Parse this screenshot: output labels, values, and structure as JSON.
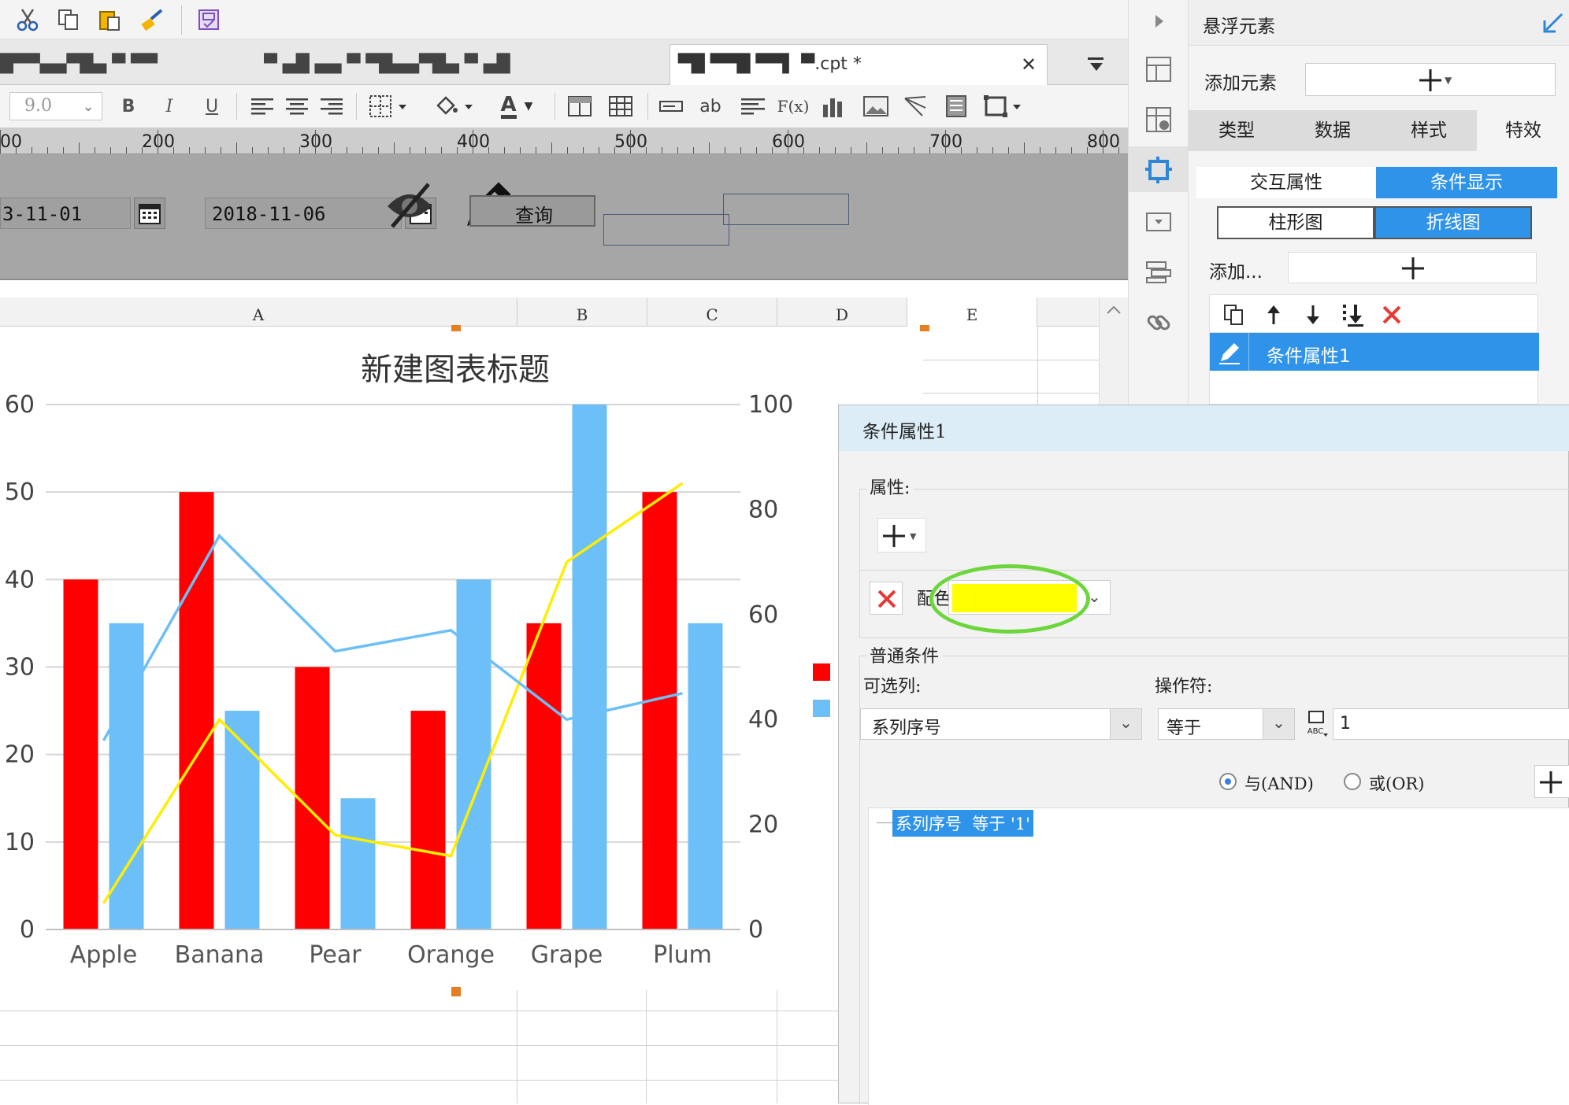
{
  "toolbar": {
    "font_size": "9.0",
    "bold": "B",
    "italic": "I",
    "underline": "U",
    "text_color_glyph": "A",
    "text_tool_glyph": "ab",
    "formula_glyph": "F(x)"
  },
  "tabs": [
    {
      "label": "█▀▀▄▄▀█▄ ▀ ▀▀"
    },
    {
      "label": "▀ ▄█ ▄▄ ▀ ▀█▄▄▀█▄ ▀ ▄█"
    },
    {
      "label": "▀█ ▀▀█ ▀▀▌ ▀.cpt *",
      "active": true
    }
  ],
  "ruler": [
    "00",
    "200",
    "300",
    "400",
    "500",
    "600",
    "700",
    "800"
  ],
  "params": {
    "start_date": "3-11-01",
    "end_date": "2018-11-06",
    "query_label": "查询"
  },
  "columns": [
    "A",
    "B",
    "C",
    "D",
    "E"
  ],
  "chart_data": {
    "type": "bar",
    "title": "新建图表标题",
    "categories": [
      "Apple",
      "Banana",
      "Pear",
      "Orange",
      "Grape",
      "Plum"
    ],
    "series": [
      {
        "kind": "bar",
        "color": "#ff0000",
        "axis": "left",
        "values": [
          40,
          50,
          30,
          25,
          35,
          50
        ]
      },
      {
        "kind": "bar",
        "color": "#6cbff7",
        "axis": "left",
        "values": [
          35,
          25,
          15,
          40,
          60,
          35
        ]
      },
      {
        "kind": "line",
        "color": "#ffee00",
        "axis": "right",
        "values": [
          5,
          40,
          18,
          14,
          70,
          85
        ]
      },
      {
        "kind": "line",
        "color": "#6cbff7",
        "axis": "right",
        "values": [
          36,
          75,
          53,
          57,
          40,
          45
        ]
      }
    ],
    "y_left": {
      "min": 0,
      "max": 60,
      "ticks": [
        0,
        10,
        20,
        30,
        40,
        50,
        60
      ]
    },
    "y_right": {
      "min": 0,
      "max": 100,
      "ticks": [
        0,
        20,
        40,
        60,
        80,
        100
      ]
    },
    "grid": true,
    "legend": "right"
  },
  "right_panel": {
    "title": "悬浮元素",
    "add_element_label": "添加元素",
    "tabs": [
      "类型",
      "数据",
      "样式",
      "特效"
    ],
    "active_tab": "特效",
    "subtabs": [
      "交互属性",
      "条件显示"
    ],
    "chart_tabs": [
      "柱形图",
      "折线图"
    ],
    "add_label": "添加...",
    "condition_item": "条件属性1"
  },
  "dialog": {
    "title": "条件属性1",
    "property_label": "属性:",
    "color_label": "配色",
    "color_value": "#ffff00",
    "general_condition": "普通条件",
    "optional_column_label": "可选列:",
    "operator_label": "操作符:",
    "column_value": "系列序号",
    "operator_value": "等于",
    "value": "1",
    "and_label": "与(AND)",
    "or_label": "或(OR)",
    "condition_text": "系列序号  等于 '1'"
  }
}
